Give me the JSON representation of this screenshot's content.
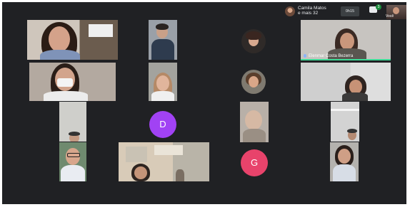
{
  "header": {
    "pinned_name": "Camila Matos",
    "more_count": "e mais 32",
    "time_badge": "0h15"
  },
  "chat": {
    "badge_count": "3"
  },
  "self_view": {
    "label": "Você"
  },
  "active_speaker": {
    "name": "Elenmar Costa Bezerra"
  },
  "avatars": [
    {
      "letter": "D",
      "color": "#a142f4"
    },
    {
      "letter": "G",
      "color": "#e8436b"
    }
  ]
}
